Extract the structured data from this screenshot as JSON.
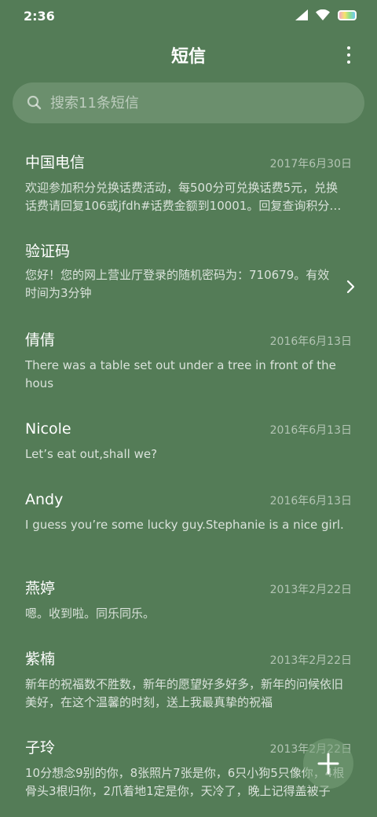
{
  "status_bar": {
    "time": "2:36",
    "icons": [
      "cellular-signal-icon",
      "wifi-icon",
      "battery-icon"
    ]
  },
  "header": {
    "title": "短信",
    "more_icon": "more-vertical-icon"
  },
  "search": {
    "placeholder": "搜索11条短信",
    "icon": "search-icon"
  },
  "messages": [
    {
      "sender": "中国电信",
      "date": "2017年6月30日",
      "preview": "欢迎参加积分兑换话费活动，每500分可兑换话费5元，兑换话费请回复106或jfdh#话费金额到10001。回复查询积分余额"
    },
    {
      "sender": "验证码",
      "date": "",
      "preview": "您好！您的网上营业厅登录的随机密码为：710679。有效时间为3分钟"
    },
    {
      "sender": "倩倩",
      "date": "2016年6月13日",
      "preview": "There was a table set out under a tree in front of the hous"
    },
    {
      "sender": "Nicole",
      "date": "2016年6月13日",
      "preview": "Let’s eat out,shall we?"
    },
    {
      "sender": "Andy",
      "date": "2016年6月13日",
      "preview": "I guess you’re some lucky guy.Stephanie is a nice girl."
    },
    {
      "sender": "燕婷",
      "date": "2013年2月22日",
      "preview": "嗯。收到啦。同乐同乐。"
    },
    {
      "sender": "紫楠",
      "date": "2013年2月22日",
      "preview": "新年的祝福数不胜数，新年的愿望好多好多，新年的问候依旧美好，在这个温馨的时刻，送上我最真挚的祝福"
    },
    {
      "sender": "子玲",
      "date": "2013年2月22日",
      "preview": "10分想念9别的你，8张照片7张是你，6只小狗5只像你，4根骨头3根归你，2爪着地1定是你，天冷了，晚上记得盖被子"
    }
  ],
  "fab": {
    "icon": "plus-icon"
  },
  "colors": {
    "background": "#547c57",
    "search_background": "#6b8f6d",
    "text_primary": "#ffffff"
  }
}
